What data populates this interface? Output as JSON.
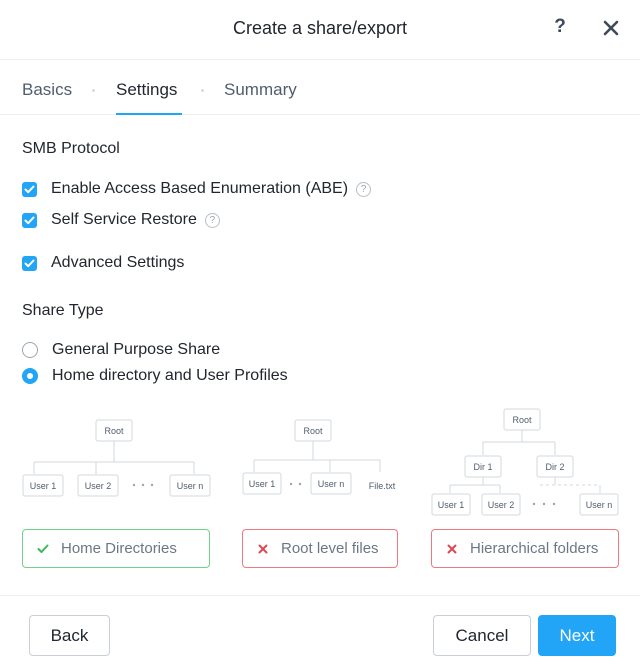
{
  "dialog": {
    "title": "Create a share/export",
    "help_label": "?"
  },
  "tabs": [
    {
      "label": "Basics",
      "active": false
    },
    {
      "label": "Settings",
      "active": true
    },
    {
      "label": "Summary",
      "active": false
    }
  ],
  "smb": {
    "section_title": "SMB Protocol",
    "options": [
      {
        "label": "Enable Access Based Enumeration (ABE)",
        "checked": true,
        "info_icon": "question-circle-icon"
      },
      {
        "label": "Self Service Restore",
        "checked": true,
        "info_icon": "question-circle-icon"
      },
      {
        "label": "Advanced Settings",
        "checked": true
      }
    ],
    "info_glyph": "?"
  },
  "share_type": {
    "section_title": "Share Type",
    "options": [
      {
        "label": "General Purpose Share",
        "selected": false
      },
      {
        "label": "Home directory and User Profiles",
        "selected": true
      }
    ]
  },
  "diagrams": {
    "home": {
      "root": "Root",
      "users": [
        "User 1",
        "User 2",
        "User n"
      ]
    },
    "root_files": {
      "root": "Root",
      "users": [
        "User 1",
        "User n"
      ],
      "file": "File.txt"
    },
    "hierarchical": {
      "root": "Root",
      "dirs": [
        "Dir 1",
        "Dir 2"
      ],
      "users": [
        "User 1",
        "User 2",
        "User n"
      ]
    }
  },
  "structure_options": [
    {
      "label": "Home Directories",
      "status": "allowed",
      "icon": "check-icon",
      "color": "#3bb85a"
    },
    {
      "label": "Root level files",
      "status": "not-allowed",
      "icon": "x-icon",
      "color": "#e0474f"
    },
    {
      "label": "Hierarchical folders",
      "status": "not-allowed",
      "icon": "x-icon",
      "color": "#e0474f"
    }
  ],
  "footer": {
    "back_label": "Back",
    "cancel_label": "Cancel",
    "next_label": "Next"
  },
  "colors": {
    "accent": "#22a5f7",
    "success_border": "#6fd18b",
    "error_border": "#ee7a80"
  }
}
